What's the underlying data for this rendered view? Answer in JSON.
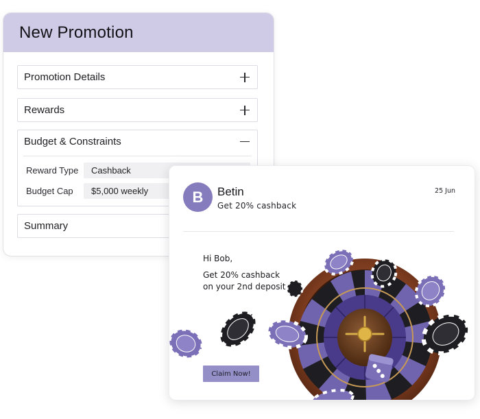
{
  "promotion": {
    "title": "New Promotion",
    "sections": [
      {
        "label": "Promotion Details",
        "state": "collapsed"
      },
      {
        "label": "Rewards",
        "state": "collapsed"
      },
      {
        "label": "Budget & Constraints",
        "state": "expanded"
      },
      {
        "label": "Summary",
        "state": "collapsed"
      }
    ],
    "fields": [
      {
        "label": "Reward Type",
        "value": "Cashback"
      },
      {
        "label": "Budget Cap",
        "value": "$5,000 weekly"
      }
    ]
  },
  "notification": {
    "avatar_initial": "B",
    "sender": "Betin",
    "subject": "Get 20% cashback",
    "date": "25 Jun",
    "greeting": "Hi Bob,",
    "body_lines": [
      "Get 20% cashback",
      "on your 2nd deposit"
    ],
    "cta_label": "Claim Now!",
    "illustration": "roulette-wheel-with-casino-chips-and-dice"
  },
  "colors": {
    "header_bg": "#cfcbe6",
    "accent": "#857cbd",
    "cta_bg": "#958fc7",
    "chip_purple": "#7b6fb8"
  }
}
